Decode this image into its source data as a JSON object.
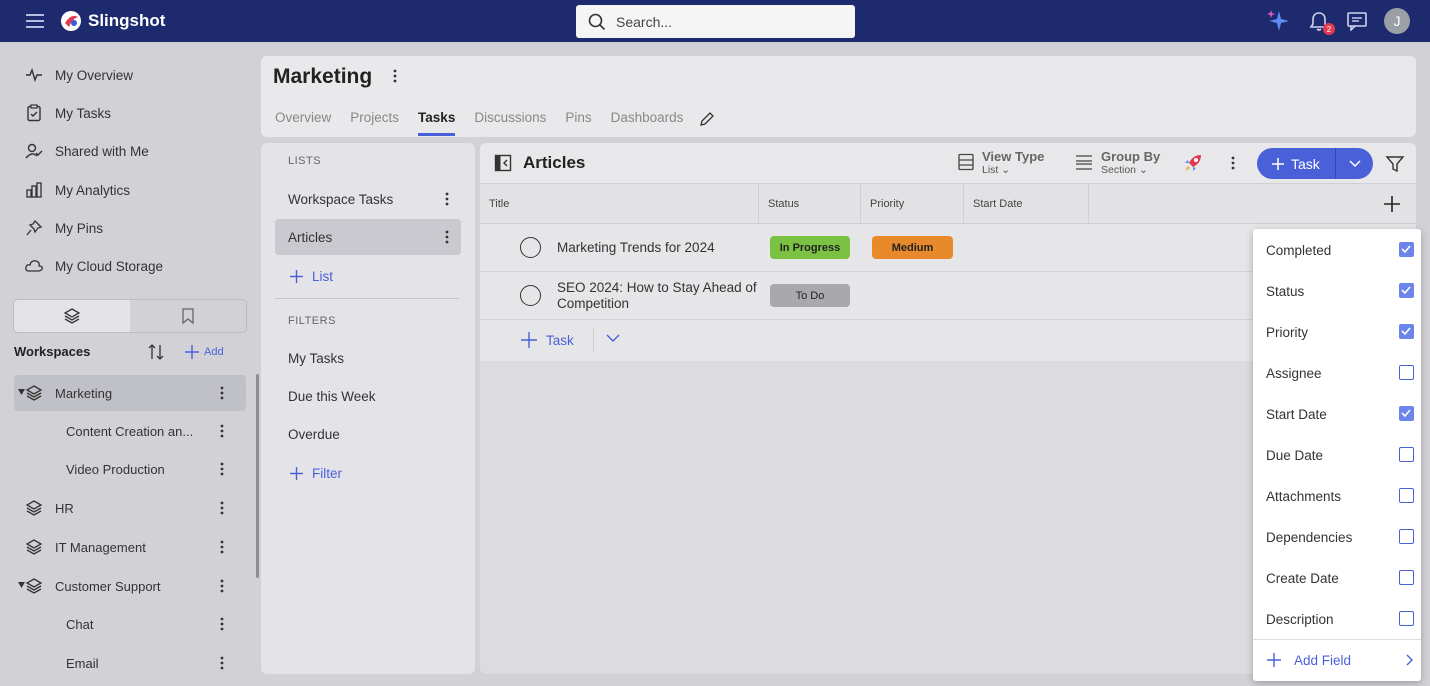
{
  "app": {
    "name": "Slingshot"
  },
  "search": {
    "placeholder": "Search..."
  },
  "notifications": {
    "count": "2"
  },
  "user": {
    "initial": "J"
  },
  "nav": {
    "items": [
      {
        "label": "My Overview",
        "icon": "activity-icon"
      },
      {
        "label": "My Tasks",
        "icon": "clipboard-check-icon"
      },
      {
        "label": "Shared with Me",
        "icon": "user-check-icon"
      },
      {
        "label": "My Analytics",
        "icon": "bar-chart-icon"
      },
      {
        "label": "My Pins",
        "icon": "pin-icon"
      },
      {
        "label": "My Cloud Storage",
        "icon": "cloud-icon"
      }
    ]
  },
  "workspaces": {
    "heading": "Workspaces",
    "add_label": "Add",
    "items": [
      {
        "label": "Marketing",
        "level": 0,
        "expanded": true,
        "selected": true
      },
      {
        "label": "Content Creation an...",
        "level": 1
      },
      {
        "label": "Video Production",
        "level": 1
      },
      {
        "label": "HR",
        "level": 0
      },
      {
        "label": "IT Management",
        "level": 0
      },
      {
        "label": "Customer Support",
        "level": 0,
        "expanded": true
      },
      {
        "label": "Chat",
        "level": 1
      },
      {
        "label": "Email",
        "level": 1
      }
    ]
  },
  "header": {
    "title": "Marketing",
    "tabs": [
      "Overview",
      "Projects",
      "Tasks",
      "Discussions",
      "Pins",
      "Dashboards"
    ],
    "active_tab": "Tasks"
  },
  "lists_panel": {
    "lists_heading": "LISTS",
    "lists": [
      "Workspace Tasks",
      "Articles"
    ],
    "selected_list": "Articles",
    "add_list_label": "List",
    "filters_heading": "FILTERS",
    "filters": [
      "My Tasks",
      "Due this Week",
      "Overdue"
    ],
    "add_filter_label": "Filter"
  },
  "main": {
    "title": "Articles",
    "view_type": {
      "label": "View Type",
      "value": "List"
    },
    "group_by": {
      "label": "Group By",
      "value": "Section"
    },
    "task_button": "Task",
    "columns": [
      "Title",
      "Status",
      "Priority",
      "Start Date"
    ],
    "rows": [
      {
        "title": "Marketing Trends for 2024",
        "status": "In Progress",
        "status_color": "#7cc242",
        "priority": "Medium",
        "priority_color": "#e8892b"
      },
      {
        "title": "SEO 2024: How to Stay Ahead of Competition",
        "status": "To Do",
        "status_color": "#a9a9ad",
        "priority": "",
        "priority_color": ""
      }
    ],
    "add_task_label": "Task"
  },
  "field_menu": {
    "options": [
      {
        "label": "Completed",
        "checked": true
      },
      {
        "label": "Status",
        "checked": true
      },
      {
        "label": "Priority",
        "checked": true
      },
      {
        "label": "Assignee",
        "checked": false
      },
      {
        "label": "Start Date",
        "checked": true
      },
      {
        "label": "Due Date",
        "checked": false
      },
      {
        "label": "Attachments",
        "checked": false
      },
      {
        "label": "Dependencies",
        "checked": false
      },
      {
        "label": "Create Date",
        "checked": false
      },
      {
        "label": "Description",
        "checked": false
      }
    ],
    "add_field_label": "Add Field"
  },
  "colors": {
    "accent": "#4a60d9",
    "topbar": "#1e2a6e"
  }
}
